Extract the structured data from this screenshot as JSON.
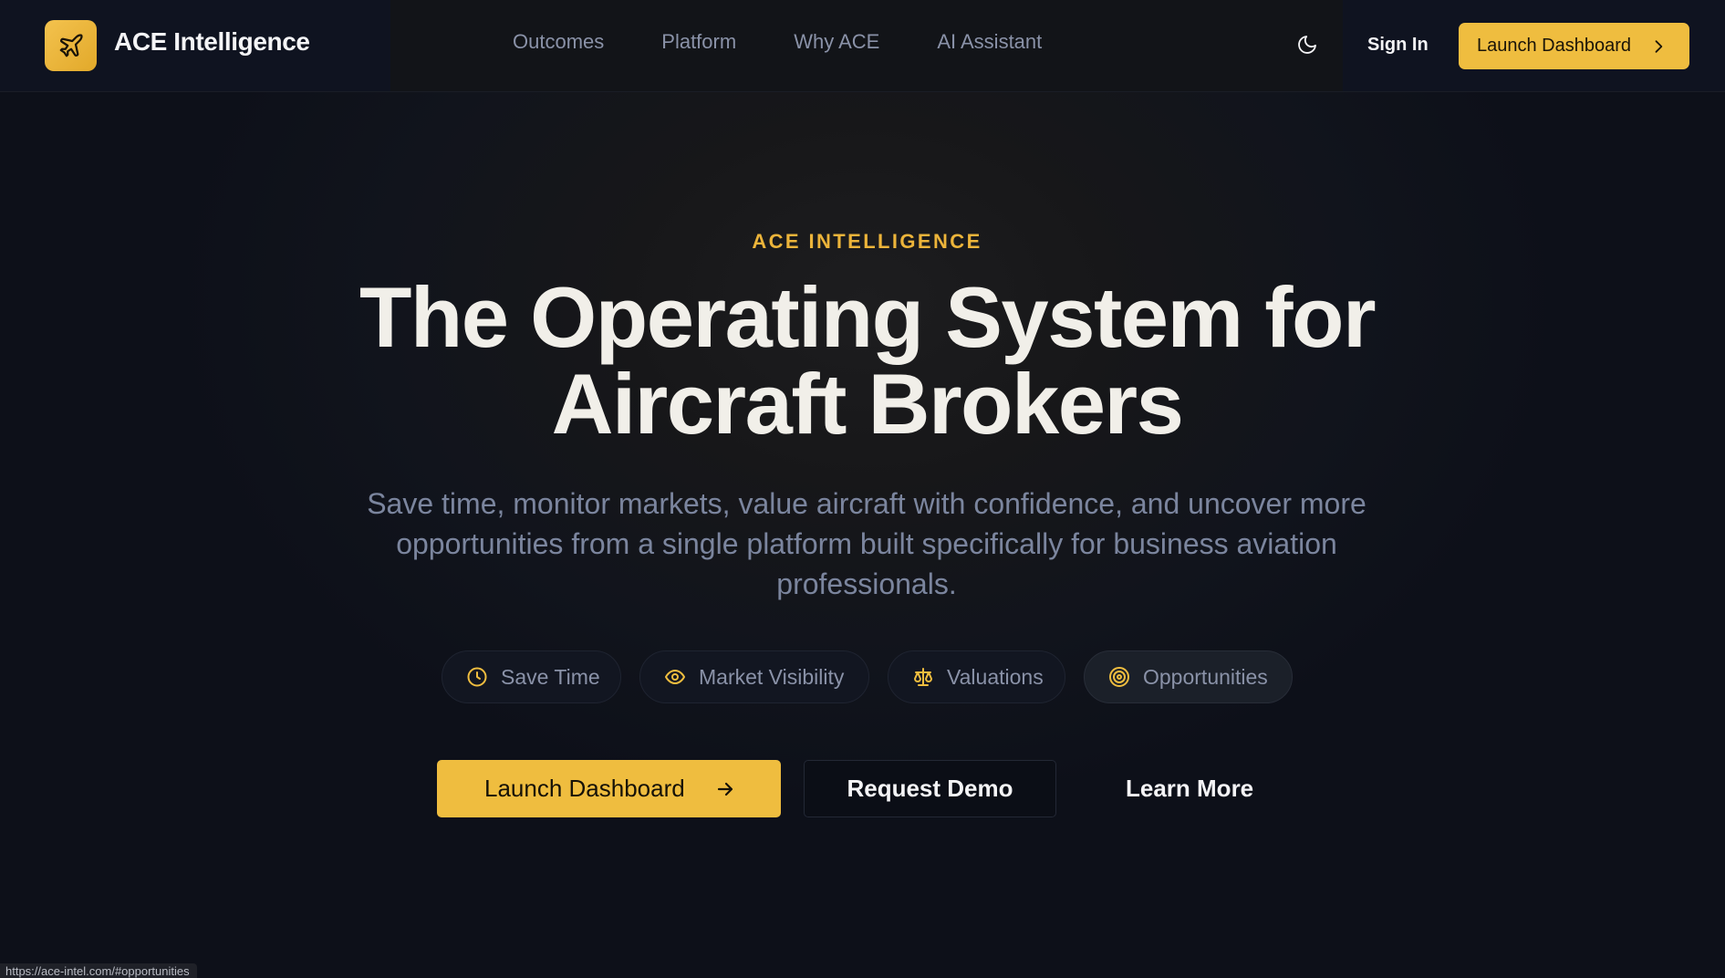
{
  "nav": {
    "brand": "ACE Intelligence",
    "logo_icon": "plane-icon",
    "links": [
      "Outcomes",
      "Platform",
      "Why ACE",
      "AI Assistant"
    ],
    "theme_icon": "moon-icon",
    "sign_in": "Sign In",
    "cta": "Launch Dashboard",
    "cta_icon": "chevron-right-icon"
  },
  "hero": {
    "eyebrow": "ACE INTELLIGENCE",
    "title_line1": "The Operating System for",
    "title_line2": "Aircraft Brokers",
    "subtitle": "Save time, monitor markets, value aircraft with confidence, and uncover more opportunities from a single platform built specifically for business aviation professionals.",
    "pills": [
      {
        "label": "Save Time",
        "icon": "clock-icon"
      },
      {
        "label": "Market Visibility",
        "icon": "eye-icon"
      },
      {
        "label": "Valuations",
        "icon": "scale-icon"
      },
      {
        "label": "Opportunities",
        "icon": "target-icon"
      }
    ],
    "primary_cta": "Launch Dashboard",
    "secondary_cta": "Request Demo",
    "tertiary_cta": "Learn More"
  },
  "status_bar": {
    "url": "https://ace-intel.com/#opportunities"
  },
  "colors": {
    "accent": "#efbd3f",
    "background": "#0d1019",
    "heading": "#f1efe9",
    "muted": "#7b859e"
  }
}
